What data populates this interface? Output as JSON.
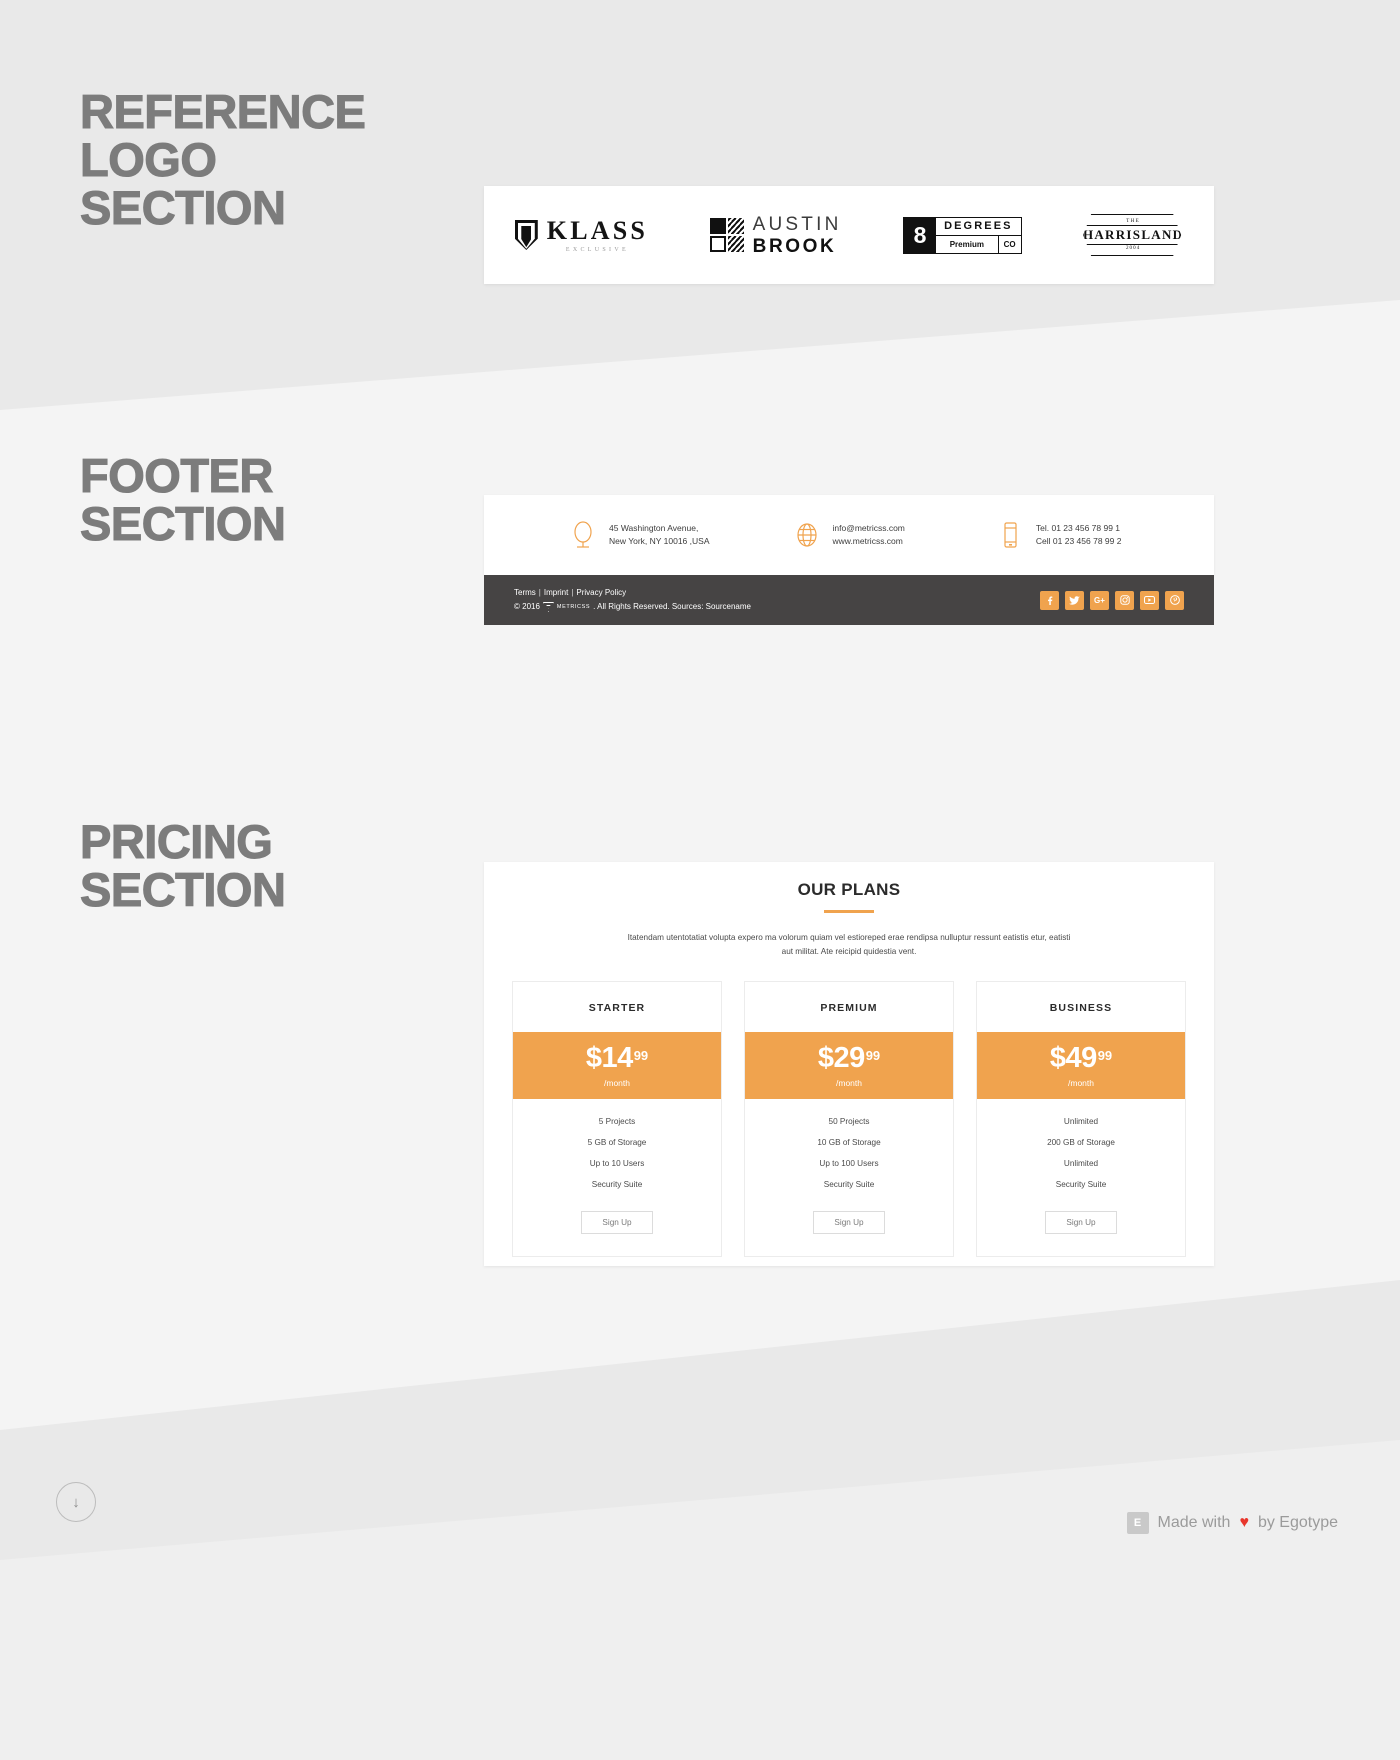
{
  "sections": {
    "reference_logo": {
      "line1": "REFERENCE",
      "line2": "LOGO",
      "line3": "SECTION"
    },
    "footer": {
      "line1": "FOOTER",
      "line2": "SECTION"
    },
    "pricing": {
      "line1": "PRICING",
      "line2": "SECTION"
    }
  },
  "logo_strip": {
    "logos": [
      {
        "id": "klass",
        "name": "KLASS",
        "tagline": "EXCLUSIVE"
      },
      {
        "id": "austin-brook",
        "line1": "AUSTIN",
        "line2": "BROOK"
      },
      {
        "id": "eight-degrees",
        "number": "8",
        "word": "DEGREES",
        "premium": "Premium",
        "co": "CO"
      },
      {
        "id": "harrisland",
        "the": "THE",
        "name": "HARRISLAND",
        "year": "2004"
      }
    ]
  },
  "footer": {
    "contacts": [
      {
        "icon": "location-pin-icon",
        "line1": "45 Washington Avenue,",
        "line2": "New York, NY 10016 ,USA"
      },
      {
        "icon": "globe-icon",
        "line1": "info@metricss.com",
        "line2": "www.metricss.com"
      },
      {
        "icon": "mobile-phone-icon",
        "line1": "Tel. 01 23 456 78 99 1",
        "line2": "Cell 01 23 456 78 99 2"
      }
    ],
    "legal": {
      "links": [
        "Terms",
        "Imprint",
        "Privacy Policy"
      ],
      "separator": "|",
      "copyright_prefix": "© 2016",
      "brand": "METRICSS",
      "copyright_suffix": ". All Rights Reserved. Sources: Sourcename"
    },
    "social": [
      {
        "name": "facebook",
        "glyph": "f"
      },
      {
        "name": "twitter",
        "glyph": "🐦"
      },
      {
        "name": "google-plus",
        "glyph": "G+"
      },
      {
        "name": "instagram",
        "glyph": "◉"
      },
      {
        "name": "youtube",
        "glyph": "▶"
      },
      {
        "name": "pinterest",
        "glyph": "P"
      }
    ],
    "accent_color": "#F0A34E",
    "bar_color": "#464444"
  },
  "pricing": {
    "title": "OUR PLANS",
    "description": "Itatendam utentotatiat volupta expero ma volorum quiam vel estioreped erae rendipsa nulluptur ressunt eatistis etur, eatisti aut militat. Ate reicipid quidestia vent.",
    "accent_color": "#F0A34E",
    "plans": [
      {
        "name": "STARTER",
        "price": "$14",
        "cents": "99",
        "period": "/month",
        "features": [
          "5 Projects",
          "5 GB of Storage",
          "Up to 10 Users",
          "Security Suite"
        ],
        "cta": "Sign Up"
      },
      {
        "name": "PREMIUM",
        "price": "$29",
        "cents": "99",
        "period": "/month",
        "features": [
          "50 Projects",
          "10 GB of Storage",
          "Up to 100 Users",
          "Security Suite"
        ],
        "cta": "Sign Up"
      },
      {
        "name": "BUSINESS",
        "price": "$49",
        "cents": "99",
        "period": "/month",
        "features": [
          "Unlimited",
          "200 GB of Storage",
          "Unlimited",
          "Security Suite"
        ],
        "cta": "Sign Up"
      }
    ]
  },
  "chrome": {
    "scroll_arrow": "↓",
    "made_with_prefix": "Made with",
    "made_with_suffix": "by Egotype",
    "heart": "♥",
    "egotype_mark": "E"
  }
}
